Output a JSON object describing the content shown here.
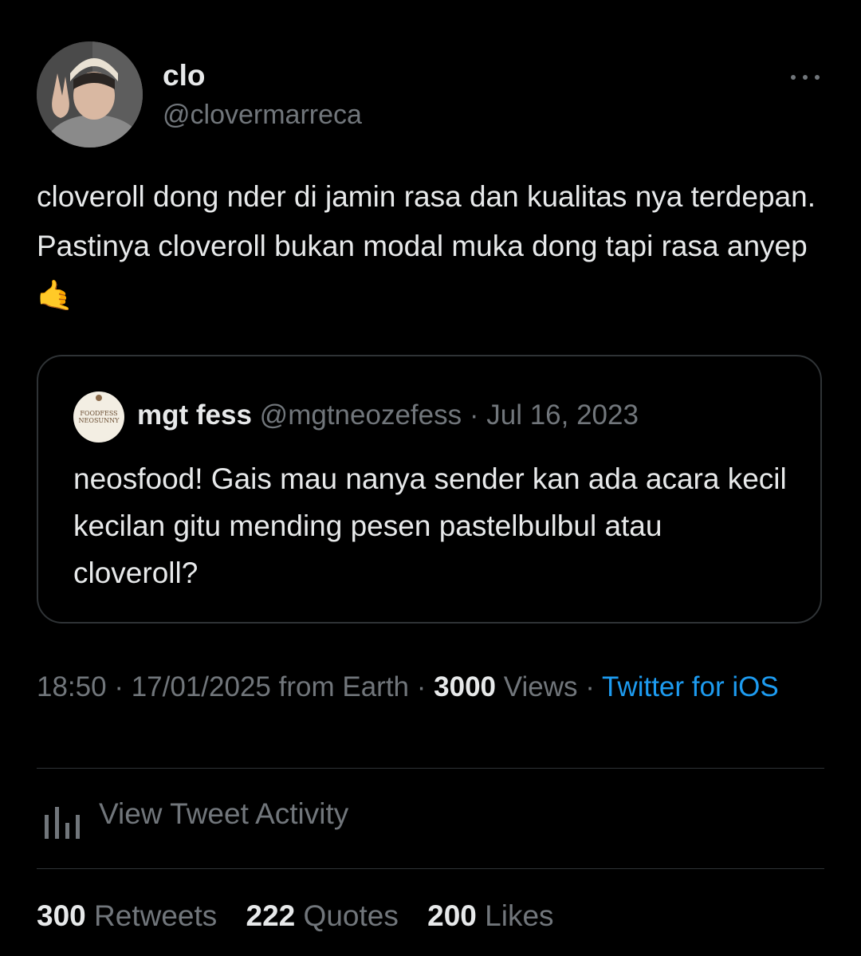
{
  "author": {
    "display_name": "clo",
    "handle": "@clovermarreca",
    "avatar_icon": "user-photo-avatar"
  },
  "more_icon": "more-horizontal-icon",
  "tweet": {
    "text": "cloveroll dong nder di jamin rasa dan kualitas nya terdepan. Pastinya cloveroll bukan modal muka dong tapi rasa anyep",
    "emoji": "🤙"
  },
  "quote": {
    "avatar_lines": [
      "FOODFESS",
      "NEOSUNNY"
    ],
    "display_name": "mgt fess",
    "handle": "@mgtneozefess",
    "separator": "·",
    "date": "Jul 16, 2023",
    "text": "neosfood! Gais mau nanya sender kan ada acara kecil kecilan gitu mending pesen pastelbulbul atau cloveroll?"
  },
  "meta": {
    "time": "18:50",
    "date": "17/01/2025",
    "location": "from Earth",
    "views_count": "3000",
    "views_label": "Views",
    "source": "Twitter for iOS",
    "separator": "·"
  },
  "activity": {
    "label": "View Tweet Activity",
    "icon": "analytics-bar-chart-icon"
  },
  "stats": [
    {
      "count": "300",
      "label": "Retweets"
    },
    {
      "count": "222",
      "label": "Quotes"
    },
    {
      "count": "200",
      "label": "Likes"
    }
  ],
  "colors": {
    "background": "#000000",
    "text": "#e7e9ea",
    "muted": "#71767b",
    "link": "#1d9bf0",
    "border": "#2f3336"
  }
}
